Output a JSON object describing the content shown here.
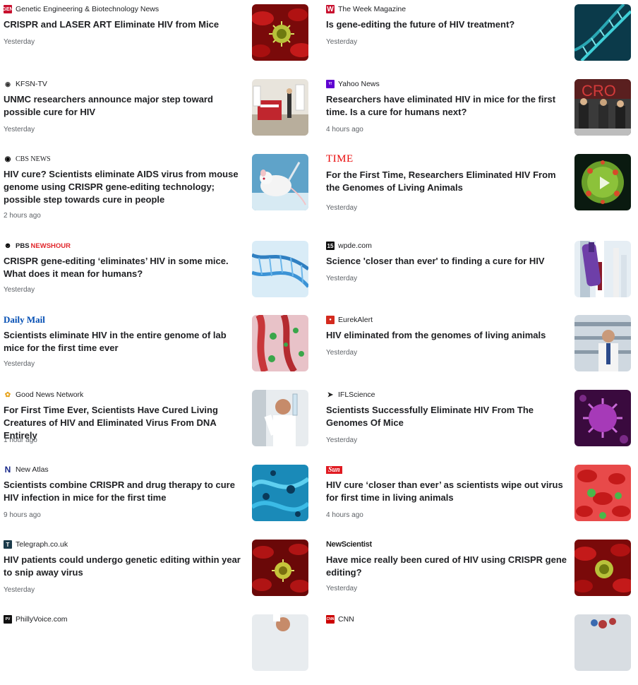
{
  "colors": {
    "headline": "#202124",
    "meta": "#5f6368"
  },
  "stories": [
    {
      "source": "Genetic Engineering & Biotechnology News",
      "headline": "CRISPR and LASER ART Eliminate HIV from Mice",
      "time": "Yesterday",
      "thumb": "red-blood-cells-virus"
    },
    {
      "source": "The Week Magazine",
      "headline": "Is gene-editing the future of HIV treatment?",
      "time": "Yesterday",
      "thumb": "dna-helix-teal"
    },
    {
      "source": "KFSN-TV",
      "headline": "UNMC researchers announce major step toward possible cure for HIV",
      "time": "Yesterday",
      "thumb": "press-conference-podium"
    },
    {
      "source": "Yahoo News",
      "headline": "Researchers have eliminated HIV in mice for the first time. Is a cure for humans next?",
      "time": "4 hours ago",
      "thumb": "press-conference-crowd",
      "thumb_text": "CRO"
    },
    {
      "source": "CBS NEWS",
      "headline": "HIV cure? Scientists eliminate AIDS virus from mouse genome using CRISPR gene-editing technology; possible step towards cure in people",
      "time": "2 hours ago",
      "thumb": "lab-mouse"
    },
    {
      "source": "TIME",
      "headline": "For the First Time, Researchers Eliminated HIV From the Genomes of Living Animals",
      "time": "Yesterday",
      "thumb": "virus-video"
    },
    {
      "source": "NEWSHOUR",
      "headline": "CRISPR gene-editing ‘eliminates’ HIV in some mice. What does it mean for humans?",
      "time": "Yesterday",
      "thumb": "dna-helix-blue"
    },
    {
      "source": "wpde.com",
      "headline": "Science 'closer than ever' to finding a cure for HIV",
      "time": "Yesterday",
      "thumb": "blood-test-tubes"
    },
    {
      "source": "Daily Mail",
      "headline": "Scientists eliminate HIV in the entire genome of lab mice for the first time ever",
      "time": "Yesterday",
      "thumb": "virus-particles"
    },
    {
      "source": "EurekAlert",
      "headline": "HIV eliminated from the genomes of living animals",
      "time": "Yesterday",
      "thumb": "scientist-in-lab"
    },
    {
      "source": "Good News Network",
      "headline": "For First Time Ever, Scientists Have Cured Living Creatures of HIV and Eliminated Virus From DNA Entirely",
      "time": "1 hour ago",
      "thumb": "scientist-with-flask"
    },
    {
      "source": "IFLScience",
      "headline": "Scientists Successfully Eliminate HIV From The Genomes Of Mice",
      "time": "Yesterday",
      "thumb": "purple-virus"
    },
    {
      "source": "New Atlas",
      "headline": "Scientists combine CRISPR and drug therapy to cure HIV infection in mice for the first time",
      "time": "9 hours ago",
      "thumb": "cells-blue"
    },
    {
      "source": "Sun",
      "headline": "HIV cure ‘closer than ever’ as scientists wipe out virus for first time in living animals",
      "time": "4 hours ago",
      "thumb": "red-cells-green-virus"
    },
    {
      "source": "Telegraph.co.uk",
      "headline": "HIV patients could undergo genetic editing within year to snip away virus",
      "time": "Yesterday",
      "thumb": "red-cells-yellow-virus"
    },
    {
      "source": "NewScientist",
      "headline": "Have mice really been cured of HIV using CRISPR gene editing?",
      "time": "Yesterday",
      "thumb": "red-blood-cells-virus"
    },
    {
      "source": "PhillyVoice.com",
      "headline": "",
      "time": "",
      "thumb": "scientist-partial"
    },
    {
      "source": "CNN",
      "headline": "",
      "time": "",
      "thumb": "molecule-partial"
    }
  ]
}
